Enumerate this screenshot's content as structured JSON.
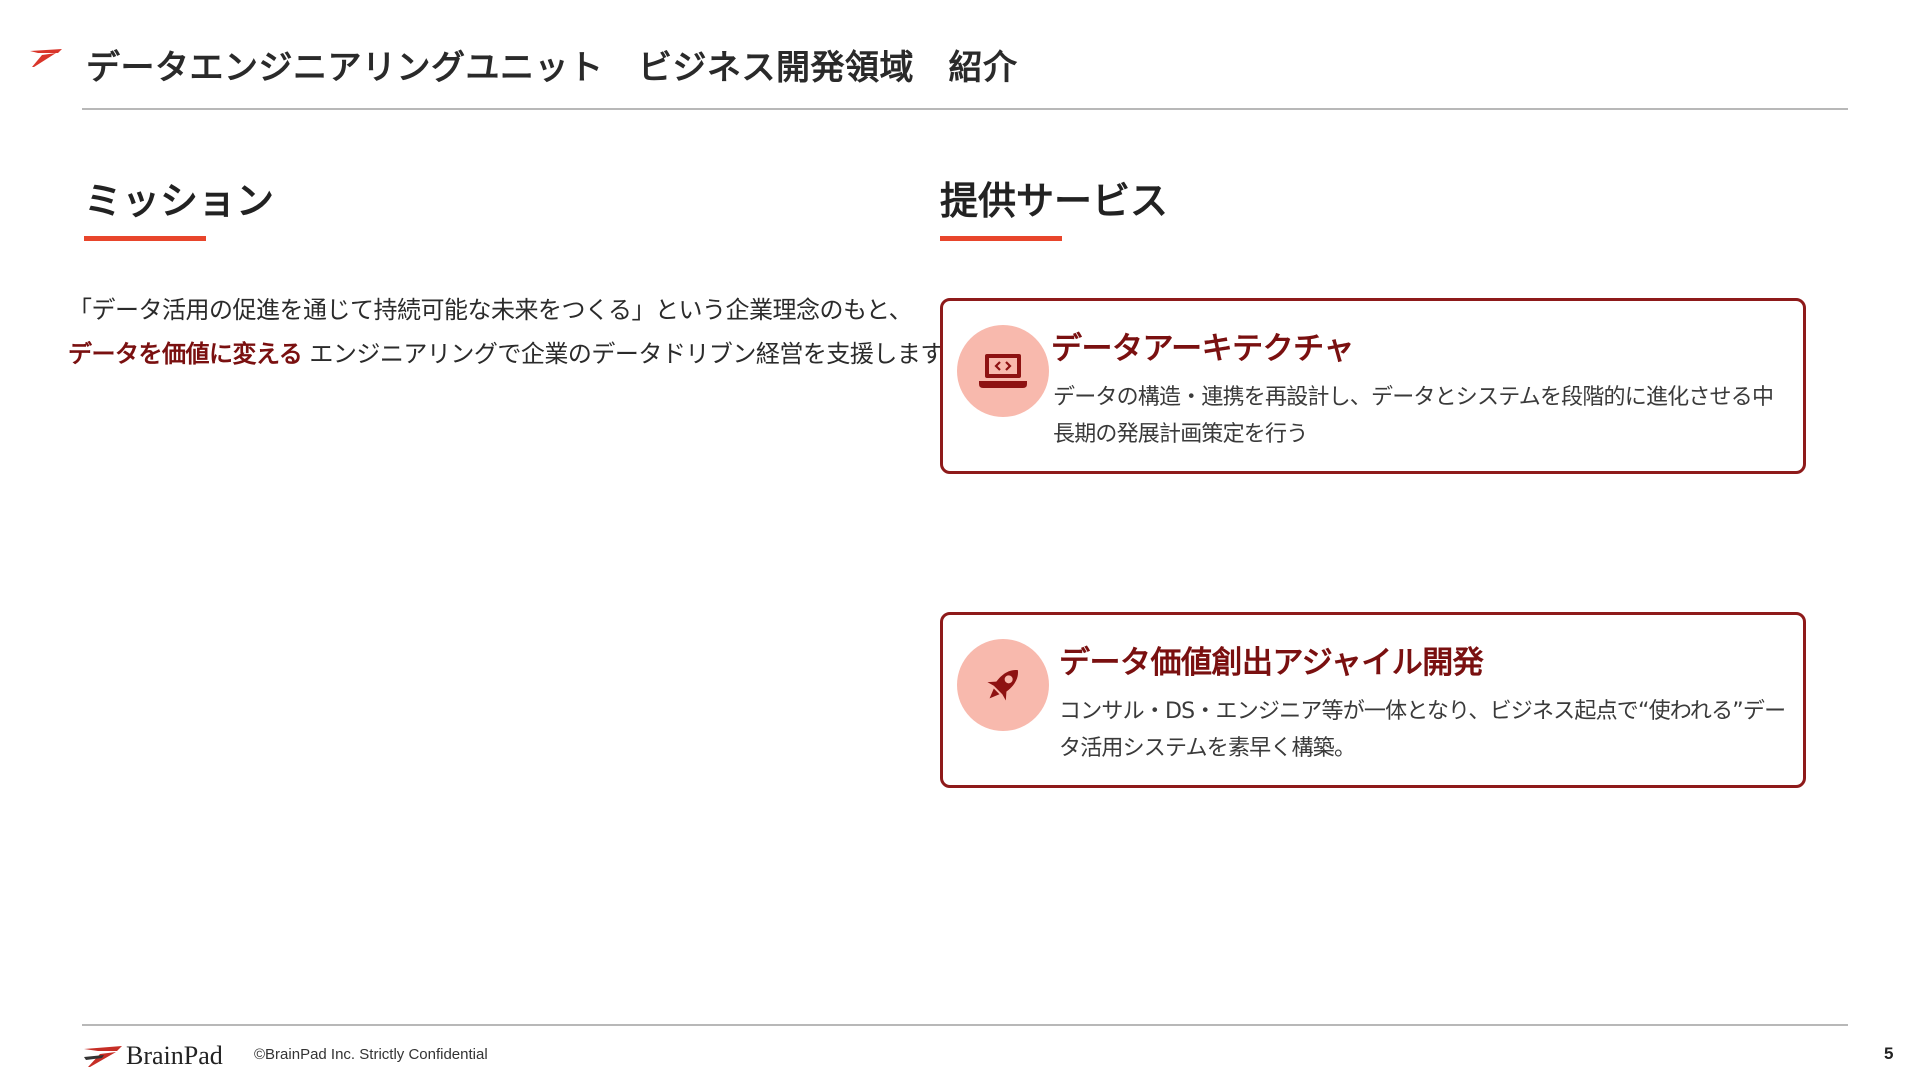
{
  "header": {
    "title": "データエンジニアリングユニット　ビジネス開発領域　紹介"
  },
  "mission": {
    "heading": "ミッション",
    "line1": "「データ活用の促進を通じて持続可能な未来をつくる」という企業理念のもと、",
    "line2_emphasis": "データを価値に変える",
    "line2_rest": " エンジニアリングで企業のデータドリブン経営を支援します。"
  },
  "services": {
    "heading": "提供サービス",
    "items": [
      {
        "title": "データアーキテクチャ",
        "description": "データの構造・連携を再設計し、データとシステムを段階的に進化させる中長期の発展計画策定を行う",
        "icon": "laptop-code-icon"
      },
      {
        "title": "データ価値創出アジャイル開発",
        "description": "コンサル・DS・エンジニア等が一体となり、ビジネス起点で“使われる”データ活用システムを素早く構築。",
        "icon": "rocket-icon"
      }
    ]
  },
  "footer": {
    "brand": "BrainPad",
    "copyright": "©BrainPad Inc.  Strictly Confidential",
    "page_number": "5"
  },
  "colors": {
    "accent": "#e8452b",
    "dark_red": "#7a1010",
    "card_border": "#8e1a1a",
    "icon_bg": "#f8b9ad"
  }
}
